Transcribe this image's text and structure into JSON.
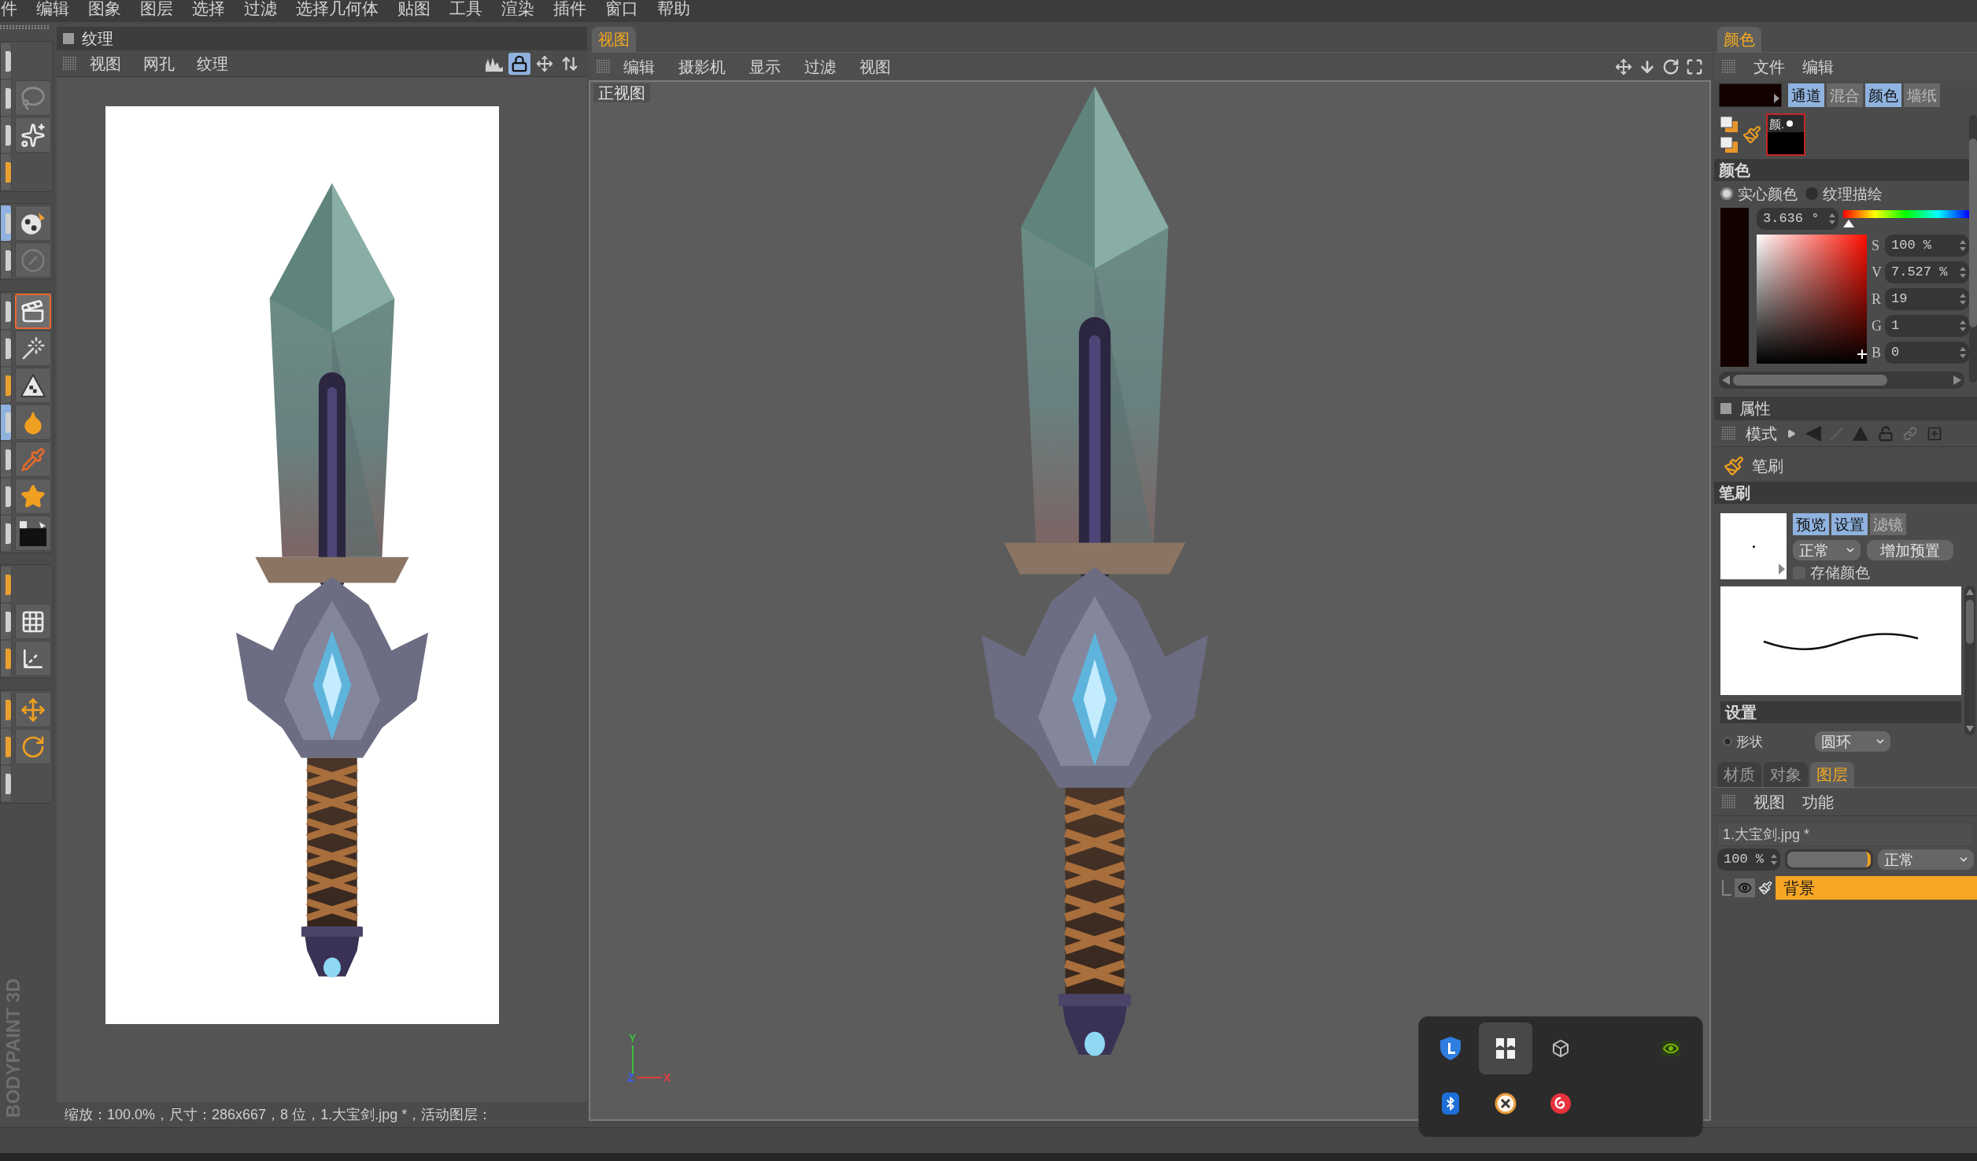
{
  "menu_bar": {
    "items": [
      "件",
      "编辑",
      "图象",
      "图层",
      "选择",
      "过滤",
      "选择几何体",
      "贴图",
      "工具",
      "渲染",
      "插件",
      "窗口",
      "帮助"
    ]
  },
  "tool_bar": {
    "groups": [
      {
        "rows": [
          {
            "edge": {
              "kind": "plain",
              "selected": false
            }
          },
          {
            "edge": {
              "kind": "plain",
              "selected": false
            },
            "tool": {
              "kind": "lasso",
              "selected": false
            }
          },
          {
            "edge": {
              "kind": "plain",
              "selected": false
            },
            "tool": {
              "kind": "sparkles",
              "selected": false
            }
          },
          {
            "edge": {
              "kind": "accent",
              "selected": false
            }
          }
        ]
      },
      {
        "rows": [
          {
            "edge": {
              "kind": "plain",
              "selected": true
            },
            "tool": {
              "kind": "ball",
              "selected": false
            }
          },
          {
            "edge": {
              "kind": "plain",
              "selected": false
            },
            "tool": {
              "kind": "slash",
              "selected": false
            }
          }
        ]
      },
      {
        "rows": [
          {
            "edge": {
              "kind": "plain",
              "selected": false
            },
            "tool": {
              "kind": "clapper",
              "selected": true
            }
          },
          {
            "edge": {
              "kind": "plain",
              "selected": false
            },
            "tool": {
              "kind": "wand",
              "selected": false
            }
          },
          {
            "edge": {
              "kind": "accent",
              "selected": false
            },
            "tool": {
              "kind": "pyramid",
              "selected": false
            }
          },
          {
            "edge": {
              "kind": "plain",
              "selected": true
            },
            "tool": {
              "kind": "fill",
              "selected": false
            }
          },
          {
            "edge": {
              "kind": "plain",
              "selected": false
            },
            "tool": {
              "kind": "dropper",
              "selected": false
            }
          },
          {
            "edge": {
              "kind": "plain",
              "selected": false
            },
            "tool": {
              "kind": "star",
              "selected": false
            }
          },
          {
            "edge": {
              "kind": "plain",
              "selected": false
            },
            "tool": {
              "kind": "swatch",
              "selected": false
            }
          }
        ]
      },
      {
        "rows": [
          {
            "edge": {
              "kind": "accent",
              "selected": false
            }
          },
          {
            "edge": {
              "kind": "plain",
              "selected": false
            },
            "tool": {
              "kind": "grid",
              "selected": false
            }
          },
          {
            "edge": {
              "kind": "accent",
              "selected": false
            },
            "tool": {
              "kind": "axes",
              "selected": false
            }
          }
        ]
      },
      {
        "rows": [
          {
            "edge": {
              "kind": "accent",
              "selected": false
            },
            "tool": {
              "kind": "move",
              "selected": false
            }
          },
          {
            "edge": {
              "kind": "accent",
              "selected": false
            },
            "tool": {
              "kind": "rotate",
              "selected": false
            }
          },
          {
            "edge": {
              "kind": "plain",
              "selected": false
            }
          }
        ]
      }
    ],
    "brand": "BODYPAINT 3D"
  },
  "texture_panel": {
    "title": "纹理",
    "menu": [
      "视图",
      "网孔",
      "纹理"
    ],
    "tools": [
      {
        "kind": "histogram",
        "selected": false
      },
      {
        "kind": "lock",
        "selected": true
      },
      {
        "kind": "move",
        "selected": false
      },
      {
        "kind": "updown",
        "selected": false
      }
    ],
    "status": "缩放：100.0%，尺寸：286x667，8 位，1.大宝剑.jpg *，活动图层："
  },
  "viewport_panel": {
    "tabs": [
      {
        "label": "视图",
        "selected": true
      }
    ],
    "menu": [
      "编辑",
      "摄影机",
      "显示",
      "过滤",
      "视图"
    ],
    "view_label": "正视图",
    "axes": [
      {
        "kind": "vertical",
        "label": "Y",
        "color": "#3cc03c"
      },
      {
        "kind": "depth",
        "label": "Z",
        "color": "#3c5cff"
      },
      {
        "kind": "horizontal",
        "label": "X",
        "color": "#e03c3c"
      }
    ]
  },
  "tray": {
    "icons": [
      {
        "kind": "shield",
        "selected": false
      },
      {
        "kind": "tiles",
        "selected": true
      },
      {
        "kind": "cube",
        "selected": false
      },
      {
        "kind": "eye",
        "selected": false
      },
      {
        "kind": "bluetooth",
        "selected": false
      },
      {
        "kind": "cross",
        "selected": false
      },
      {
        "kind": "swirl",
        "selected": false
      }
    ]
  },
  "color_panel": {
    "tabs": [
      {
        "label": "颜色",
        "selected": true
      }
    ],
    "menu": [
      "文件",
      "编辑"
    ],
    "color": "#130100",
    "modes": [
      {
        "label": "通道",
        "on": true
      },
      {
        "label": "混合",
        "on": false
      },
      {
        "label": "颜色",
        "on": true
      },
      {
        "label": "墙纸",
        "on": false
      }
    ],
    "preset_label": "颜.",
    "section": "颜色",
    "sources": [
      {
        "label": "实心颜色",
        "selected": true
      },
      {
        "label": "纹理描绘",
        "selected": false
      }
    ],
    "hue": {
      "value": "3.636 °",
      "level": 0.01
    },
    "fields": [
      {
        "label": "S",
        "value": "100 %"
      },
      {
        "label": "V",
        "value": "7.527 %"
      },
      {
        "label": "R",
        "value": "19"
      },
      {
        "label": "G",
        "value": "1"
      },
      {
        "label": "B",
        "value": "0"
      }
    ]
  },
  "attributes_panel": {
    "title": "属性",
    "menu": [
      "模式"
    ],
    "tool": "笔刷",
    "section": "笔刷",
    "tabs": [
      {
        "label": "预览",
        "on": true
      },
      {
        "label": "设置",
        "on": true
      },
      {
        "label": "滤镜",
        "on": false
      }
    ],
    "blend_mode": "正常",
    "add_preset": "增加预置",
    "store_color": {
      "label": "存储颜色",
      "checked": false
    },
    "settings_section": "设置",
    "shape": {
      "label": "形状",
      "value": "圆环"
    }
  },
  "layers_panel": {
    "tabs": [
      {
        "label": "材质",
        "selected": false
      },
      {
        "label": "对象",
        "selected": false
      },
      {
        "label": "图层",
        "selected": true
      }
    ],
    "menu": [
      "视图",
      "功能"
    ],
    "file": "1.大宝剑.jpg *",
    "opacity": {
      "value": "100 %",
      "level": 1
    },
    "blend_mode": "正常",
    "layers": [
      {
        "name": "背景",
        "selected": true,
        "visible": true
      }
    ]
  }
}
